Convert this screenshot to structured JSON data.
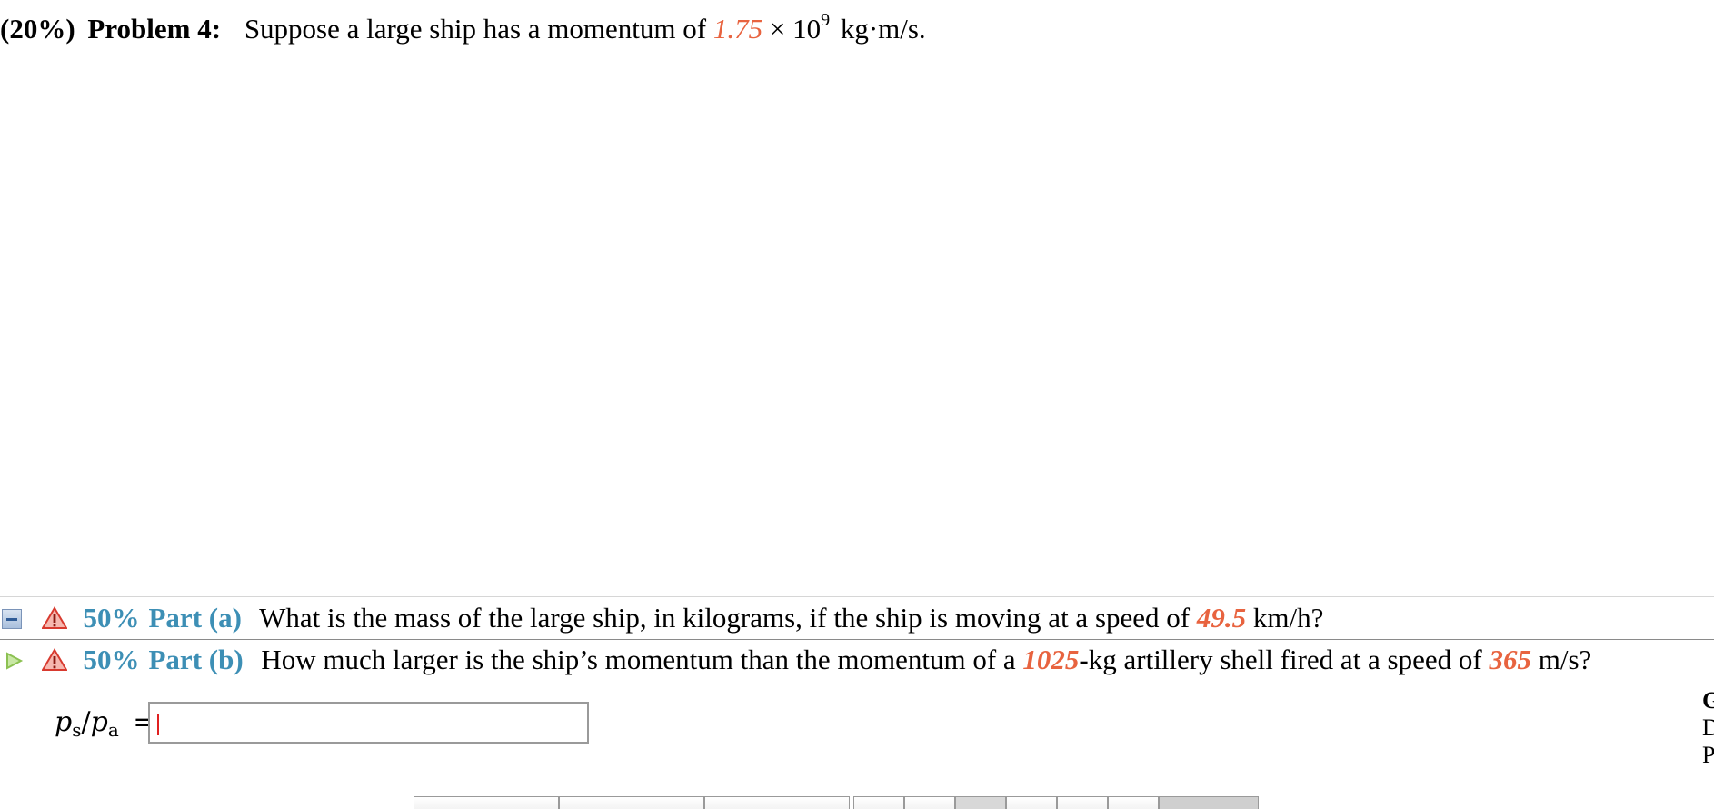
{
  "problem": {
    "weight": "(20%)",
    "title": "Problem 4:",
    "text_before": "Suppose a large ship has a momentum of",
    "momentum_value": "1.75",
    "times": "×",
    "base": "10",
    "exponent": "9",
    "unit": "kg·m/s."
  },
  "parts": [
    {
      "percent": "50%",
      "label": "Part (a)",
      "question_before": "What is the mass of the large ship, in kilograms, if the ship is moving at a speed of",
      "value1": "49.5",
      "question_after": "km/h?",
      "state": "collapsed"
    },
    {
      "percent": "50%",
      "label": "Part (b)",
      "question_before": "How much larger is the ship’s momentum than the momentum of a",
      "value1": "1025",
      "question_middle": "-kg artillery shell fired at a speed of",
      "value2": "365",
      "question_after": "m/s?",
      "state": "expanded"
    }
  ],
  "answer": {
    "var_num": "p",
    "sub_num": "s",
    "slash": "/",
    "var_den": "p",
    "sub_den": "a",
    "equals": "=",
    "value": ""
  },
  "side_panel": {
    "line1": "G",
    "line2": "D",
    "line3": "P"
  },
  "colors": {
    "given_value": "#e8633f",
    "part_label": "#3d8fb5",
    "warning": "#d83a2f",
    "expand_arrow": "#8cc152"
  }
}
